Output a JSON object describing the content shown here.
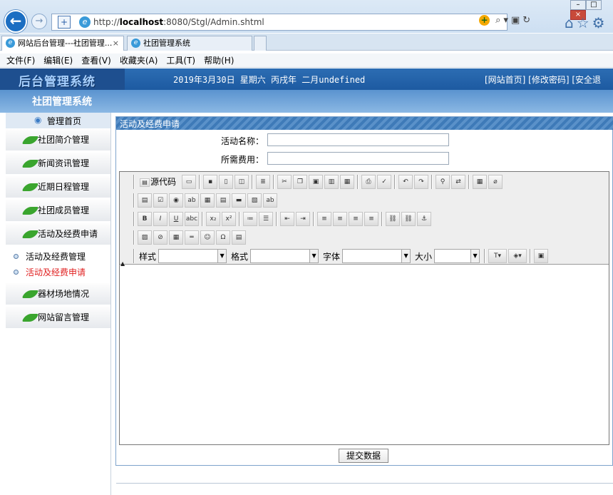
{
  "browser": {
    "url_prefix": "http://",
    "url_host": "localhost",
    "url_path": ":8080/Stgl/Admin.shtml",
    "tabs": [
      {
        "label": "网站后台管理---社团管理...",
        "close": "×"
      },
      {
        "label": "社团管理系统"
      }
    ],
    "menu": [
      "文件(F)",
      "编辑(E)",
      "查看(V)",
      "收藏夹(A)",
      "工具(T)",
      "帮助(H)"
    ]
  },
  "header": {
    "logo": "后台管理系统",
    "date": "2019年3月30日 星期六 丙戌年 二月undefined",
    "links": "[网站首页] [修改密码] [安全退",
    "system_name": "社团管理系统"
  },
  "sidebar": {
    "home": "管理首页",
    "items": [
      {
        "label": "社团简介管理"
      },
      {
        "label": "新闻资讯管理"
      },
      {
        "label": "近期日程管理"
      },
      {
        "label": "社团成员管理"
      },
      {
        "label": "活动及经费申请"
      }
    ],
    "sub_items": [
      {
        "label": "活动及经费管理"
      },
      {
        "label": "活动及经费申请",
        "active": true
      }
    ],
    "items_after": [
      {
        "label": "器材场地情况"
      },
      {
        "label": "网站留言管理"
      }
    ]
  },
  "panel": {
    "title": "活动及经费申请",
    "fields": [
      {
        "label": "活动名称：",
        "value": ""
      },
      {
        "label": "所需费用：",
        "value": ""
      }
    ],
    "submit": "提交数据"
  },
  "editor": {
    "source_label": "源代码",
    "style_label": "样式",
    "format_label": "格式",
    "font_label": "字体",
    "size_label": "大小"
  },
  "colors": {
    "header_blue": "#1d5aa1",
    "active_red": "#e02020",
    "panel_header": "#3e7ab8"
  }
}
